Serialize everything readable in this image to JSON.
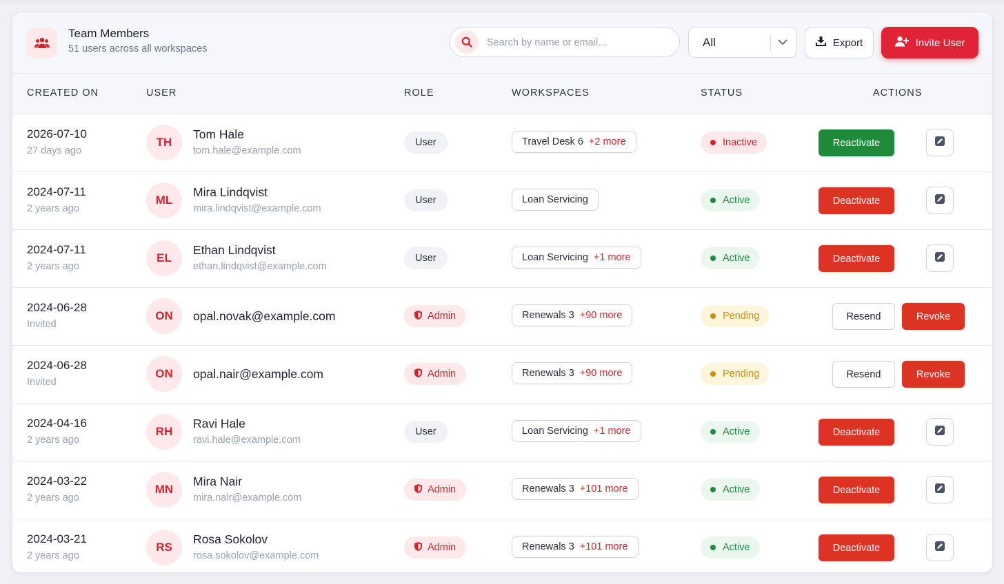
{
  "header": {
    "title": "Team Members",
    "subtitle": "51 users across all workspaces",
    "search_placeholder": "Search by name or email…",
    "filter_value": "All",
    "export_label": "Export",
    "invite_label": "Invite User",
    "icons": {
      "brand": "users-icon",
      "search": "search-icon",
      "filter": "chevron-down-icon",
      "export": "download-icon",
      "invite": "user-plus-icon"
    }
  },
  "columns": [
    "CREATED ON",
    "USER",
    "ROLE",
    "WORKSPACES",
    "STATUS",
    "ACTIONS"
  ],
  "colors": {
    "accent": "#df2535",
    "active": "#1f8a44",
    "pending": "#c9920a",
    "inactive": "#d0242f"
  },
  "rows": [
    {
      "date": "2026-07-10",
      "ago": "27 days ago",
      "initials": "TH",
      "name": "Tom Hale",
      "email": "tom.hale@example.com",
      "role": "User",
      "ws": "Travel Desk 6",
      "ws_more": "+2 more",
      "status": "Inactive",
      "status_kind": "inactive",
      "action": "Reactivate",
      "action_kind": "green",
      "edit": true
    },
    {
      "date": "2024-07-11",
      "ago": "2 years ago",
      "initials": "ML",
      "name": "Mira Lindqvist",
      "email": "mira.lindqvist@example.com",
      "role": "User",
      "ws": "Loan Servicing",
      "ws_more": "",
      "status": "Active",
      "status_kind": "active",
      "action": "Deactivate",
      "action_kind": "red",
      "edit": true
    },
    {
      "date": "2024-07-11",
      "ago": "2 years ago",
      "initials": "EL",
      "name": "Ethan Lindqvist",
      "email": "ethan.lindqvist@example.com",
      "role": "User",
      "ws": "Loan Servicing",
      "ws_more": "+1 more",
      "status": "Active",
      "status_kind": "active",
      "action": "Deactivate",
      "action_kind": "red",
      "edit": true
    },
    {
      "date": "2024-06-28",
      "ago": "Invited",
      "initials": "ON",
      "name": "opal.novak@example.com",
      "email": "",
      "role": "Admin",
      "ws": "Renewals 3",
      "ws_more": "+90 more",
      "status": "Pending",
      "status_kind": "pending",
      "action": "Resend",
      "action2": "Revoke",
      "action_kind": "invite",
      "edit": false
    },
    {
      "date": "2024-06-28",
      "ago": "Invited",
      "initials": "ON",
      "name": "opal.nair@example.com",
      "email": "",
      "role": "Admin",
      "ws": "Renewals 3",
      "ws_more": "+90 more",
      "status": "Pending",
      "status_kind": "pending",
      "action": "Resend",
      "action2": "Revoke",
      "action_kind": "invite",
      "edit": false
    },
    {
      "date": "2024-04-16",
      "ago": "2 years ago",
      "initials": "RH",
      "name": "Ravi Hale",
      "email": "ravi.hale@example.com",
      "role": "User",
      "ws": "Loan Servicing",
      "ws_more": "+1 more",
      "status": "Active",
      "status_kind": "active",
      "action": "Deactivate",
      "action_kind": "red",
      "edit": true
    },
    {
      "date": "2024-03-22",
      "ago": "2 years ago",
      "initials": "MN",
      "name": "Mira Nair",
      "email": "mira.nair@example.com",
      "role": "Admin",
      "ws": "Renewals 3",
      "ws_more": "+101 more",
      "status": "Active",
      "status_kind": "active",
      "action": "Deactivate",
      "action_kind": "red",
      "edit": true
    },
    {
      "date": "2024-03-21",
      "ago": "2 years ago",
      "initials": "RS",
      "name": "Rosa Sokolov",
      "email": "rosa.sokolov@example.com",
      "role": "Admin",
      "ws": "Renewals 3",
      "ws_more": "+101 more",
      "status": "Active",
      "status_kind": "active",
      "action": "Deactivate",
      "action_kind": "red",
      "edit": true
    }
  ]
}
